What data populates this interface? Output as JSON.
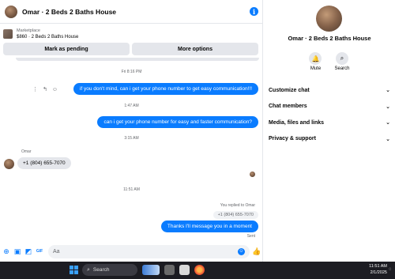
{
  "chat": {
    "title": "Omar · 2 Beds 2 Baths House",
    "info_icon": "info-icon"
  },
  "marketplace": {
    "label": "Marketplace",
    "item": "$860 · 2 Beds 2 Baths House",
    "mark_pending": "Mark as pending",
    "more_options": "More options"
  },
  "messages": {
    "ts1": "Fri 8:16 PM",
    "msg1": "if you don't mind, can i get your phone number to get easy communication!!!",
    "ts2": "1:47 AM",
    "msg2": "can i get your phone number for easy and faster communication?",
    "ts3": "3:15 AM",
    "sender": "Omar",
    "phone": "+1 (804) 655-7070",
    "ts4": "11:51 AM",
    "replied": "You replied to Omar",
    "quote": "+1 (804) 655-7070",
    "msg3": "Thanks I'll message you in a moment",
    "status": "Sent"
  },
  "composer": {
    "placeholder": "Aa"
  },
  "side": {
    "name": "Omar · 2 Beds 2 Baths House",
    "mute": "Mute",
    "search": "Search",
    "menu": [
      "Customize chat",
      "Chat members",
      "Media, files and links",
      "Privacy & support"
    ]
  },
  "taskbar": {
    "search": "Search",
    "time": "11:51 AM",
    "date": "2/1/2025"
  },
  "colors": {
    "accent": "#0a7cff",
    "bubble_in": "#e4e6eb",
    "taskbar": "#1c1c22"
  }
}
